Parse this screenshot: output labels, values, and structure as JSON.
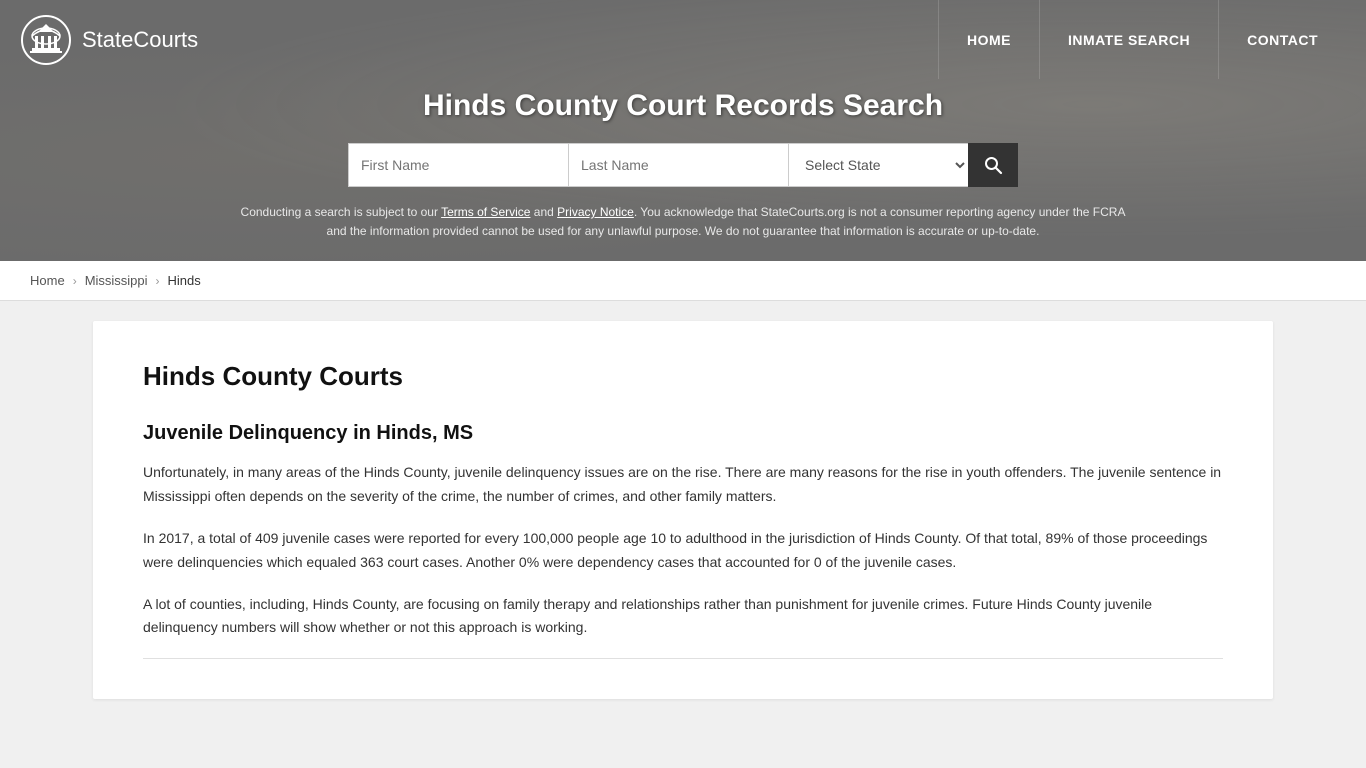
{
  "site": {
    "logo_text_bold": "State",
    "logo_text_normal": "Courts",
    "nav": {
      "home": "HOME",
      "inmate_search": "INMATE SEARCH",
      "contact": "CONTACT"
    }
  },
  "hero": {
    "title": "Hinds County Court Records Search",
    "search": {
      "first_name_placeholder": "First Name",
      "last_name_placeholder": "Last Name",
      "state_placeholder": "Select State",
      "search_icon": "🔍"
    },
    "disclaimer": "Conducting a search is subject to our Terms of Service and Privacy Notice. You acknowledge that StateCourts.org is not a consumer reporting agency under the FCRA and the information provided cannot be used for any unlawful purpose. We do not guarantee that information is accurate or up-to-date."
  },
  "breadcrumb": {
    "home": "Home",
    "state": "Mississippi",
    "current": "Hinds"
  },
  "content": {
    "heading": "Hinds County Courts",
    "section1_heading": "Juvenile Delinquency in Hinds, MS",
    "paragraph1": "Unfortunately, in many areas of the Hinds County, juvenile delinquency issues are on the rise. There are many reasons for the rise in youth offenders. The juvenile sentence in Mississippi often depends on the severity of the crime, the number of crimes, and other family matters.",
    "paragraph2": "In 2017, a total of 409 juvenile cases were reported for every 100,000 people age 10 to adulthood in the jurisdiction of Hinds County. Of that total, 89% of those proceedings were delinquencies which equaled 363 court cases. Another 0% were dependency cases that accounted for 0 of the juvenile cases.",
    "paragraph3": "A lot of counties, including, Hinds County, are focusing on family therapy and relationships rather than punishment for juvenile crimes. Future Hinds County juvenile delinquency numbers will show whether or not this approach is working."
  }
}
